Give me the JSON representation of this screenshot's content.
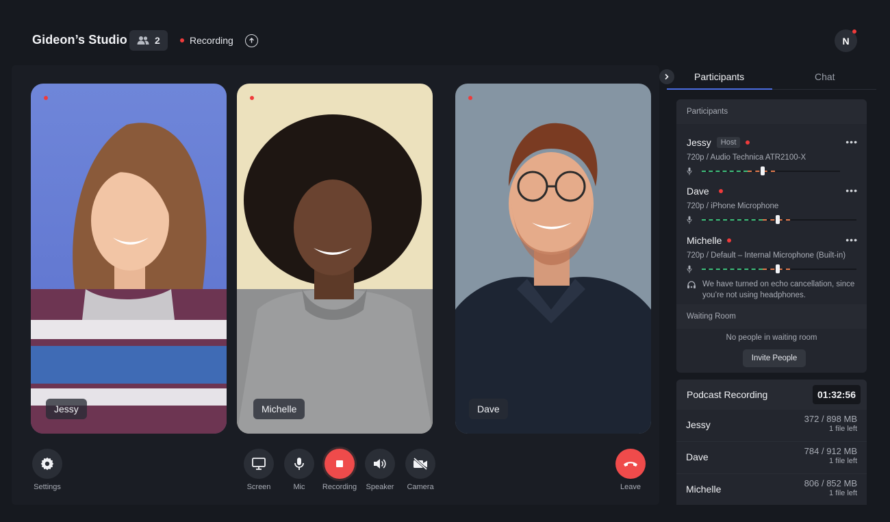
{
  "header": {
    "title": "Gideon’s Studio",
    "people_count": "2",
    "recording_label": "Recording",
    "avatar_initial": "N"
  },
  "tiles": [
    {
      "name": "Jessy"
    },
    {
      "name": "Michelle"
    },
    {
      "name": "Dave"
    }
  ],
  "controls": {
    "settings": "Settings",
    "screen": "Screen",
    "mic": "Mic",
    "recording": "Recording",
    "speaker": "Speaker",
    "camera": "Camera",
    "leave": "Leave"
  },
  "sidebar": {
    "tabs": [
      "Participants",
      "Chat"
    ],
    "participants_heading": "Participants",
    "participants": [
      {
        "name": "Jessy",
        "badge": "Host",
        "device": "720p / Audio Technica ATR2100-X",
        "level": 0.44
      },
      {
        "name": "Dave",
        "badge": "",
        "device": "720p / iPhone Microphone",
        "level": 0.49
      },
      {
        "name": "Michelle",
        "badge": "",
        "device": "720p / Default – Internal Microphone (Built-in)",
        "level": 0.49
      }
    ],
    "echo_note": "We have turned on echo cancellation, since you’re not using headphones.",
    "waiting_heading": "Waiting Room",
    "waiting_empty": "No people in waiting room",
    "invite_label": "Invite People"
  },
  "recording_panel": {
    "title": "Podcast Recording",
    "timer": "01:32:56",
    "files": [
      {
        "name": "Jessy",
        "size": "372 / 898 MB",
        "remaining": "1 file left"
      },
      {
        "name": "Dave",
        "size": "784 / 912 MB",
        "remaining": "1 file left"
      },
      {
        "name": "Michelle",
        "size": "806 / 852 MB",
        "remaining": "1 file left"
      }
    ]
  },
  "colors": {
    "background": "#16191f",
    "accent_blue": "#4b6de2",
    "recording_red": "#ef3b3b",
    "meter_green": "#3cbf7a",
    "meter_orange": "#e2794b"
  }
}
